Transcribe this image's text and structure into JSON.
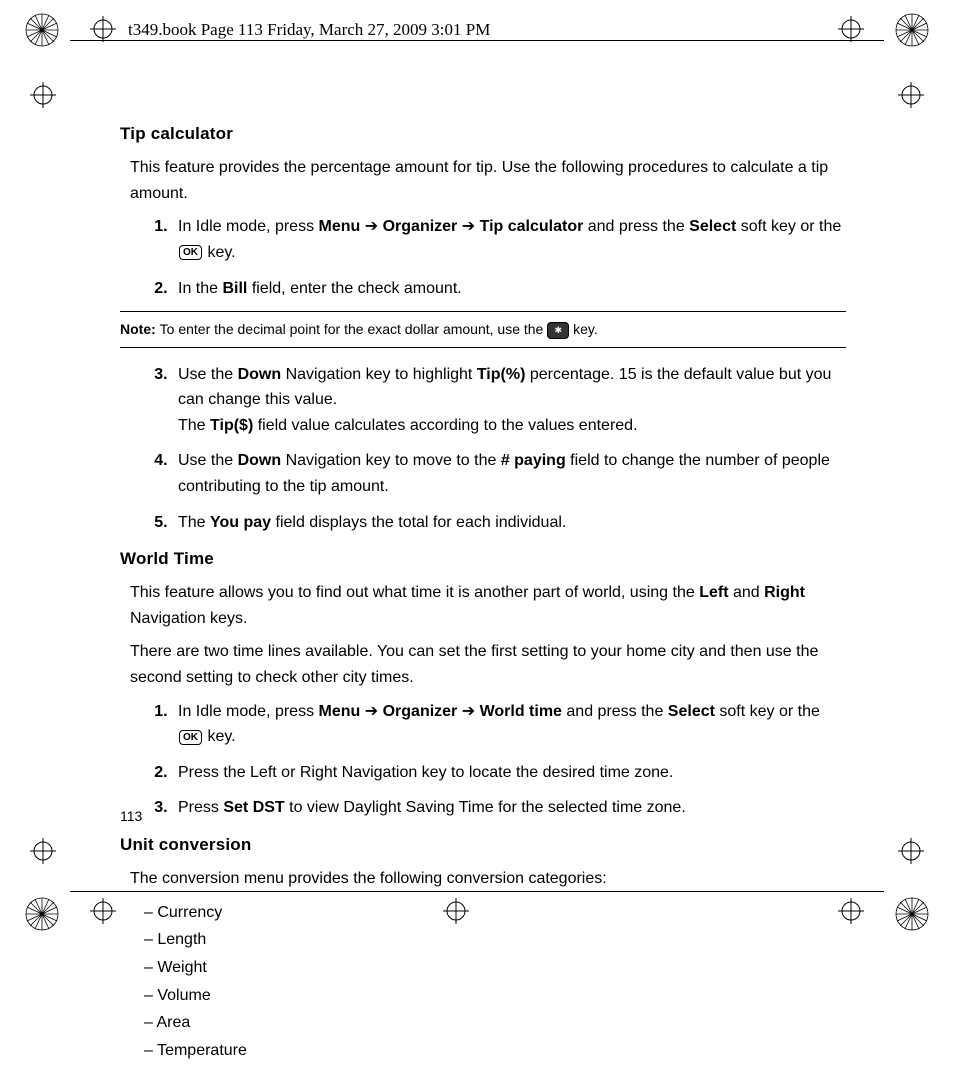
{
  "header": "t349.book  Page 113  Friday, March 27, 2009  3:01 PM",
  "s1": {
    "title": "Tip calculator",
    "intro": "This feature provides the percentage amount for tip. Use the following procedures to calculate a tip amount.",
    "step1a": "In Idle mode, press ",
    "step1b": " and press the ",
    "step1c": " soft key or the ",
    "step1d": " key.",
    "menu": "Menu",
    "organizer": "Organizer",
    "tipcalc": "Tip calculator",
    "select": "Select",
    "ok": "OK",
    "arrow": " ➔ ",
    "step2a": "In the ",
    "step2b": " field, enter the check amount.",
    "bill": "Bill",
    "note_label": "Note: ",
    "note_text1": "To enter the decimal point for the exact dollar amount, use the ",
    "note_text2": " key.",
    "step3a": "Use the ",
    "down": "Down",
    "step3b": " Navigation key to highlight ",
    "tippct": "Tip(%)",
    "step3c": " percentage. 15 is the default value but you can change this value.",
    "step3d": "The ",
    "tipdollar": "Tip($)",
    "step3e": " field value calculates according to the values entered.",
    "step4a": "Use the ",
    "step4b": " Navigation key to move to the ",
    "paying": "# paying",
    "step4c": " field to change the number of people contributing to the tip amount.",
    "step5a": "The ",
    "youpay": "You pay",
    "step5b": " field displays the total for each individual."
  },
  "s2": {
    "title": "World Time",
    "intro1a": "This feature allows you to find out what time it is another part of world, using the ",
    "left": "Left",
    "and": " and ",
    "right": "Right",
    "intro1b": " Navigation keys.",
    "intro2": "There are two time lines available. You can set the first setting to your home city and then use the second setting to check other city times.",
    "step1a": "In Idle mode, press ",
    "menu": "Menu",
    "arrow": " ➔ ",
    "organizer": "Organizer",
    "arrow2": " ➔  ",
    "worldtime": "World time",
    "step1b": " and press the ",
    "select": "Select",
    "step1c": " soft key or the ",
    "ok": "OK",
    "step1d": " key.",
    "step2": "Press the Left or Right Navigation key to locate the desired time zone.",
    "step3a": "Press ",
    "setdst": "Set DST",
    "step3b": " to view Daylight Saving Time for the selected time zone."
  },
  "s3": {
    "title": "Unit conversion",
    "intro": "The conversion menu provides the following conversion categories:",
    "items": [
      "Currency",
      "Length",
      "Weight",
      "Volume",
      "Area",
      "Temperature"
    ]
  },
  "page_number": "113"
}
